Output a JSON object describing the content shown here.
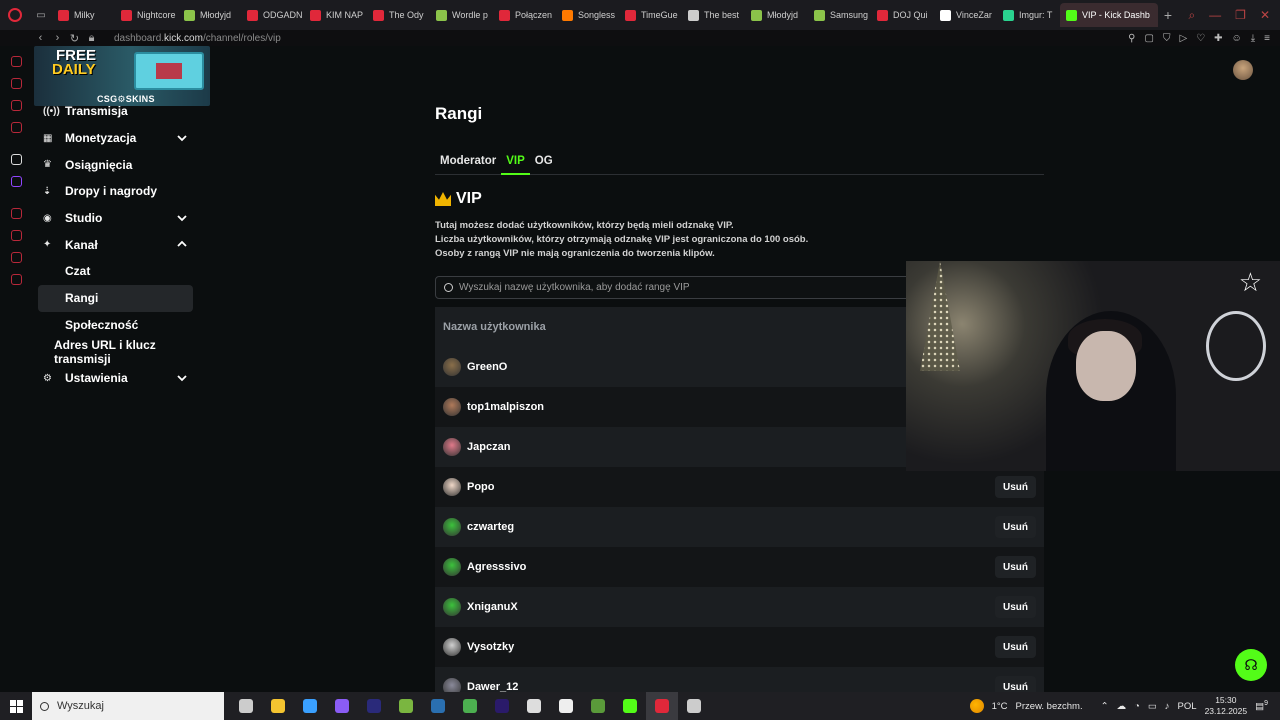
{
  "browser": {
    "tabs": [
      {
        "label": "Milky",
        "color": "#e0283a"
      },
      {
        "label": "Nightcore",
        "color": "#e0283a"
      },
      {
        "label": "Młodyjd",
        "color": "#8bc34a"
      },
      {
        "label": "ODGADN",
        "color": "#e0283a"
      },
      {
        "label": "KIM NAP",
        "color": "#e0283a"
      },
      {
        "label": "The Ody",
        "color": "#e0283a"
      },
      {
        "label": "Wordle p",
        "color": "#8bc34a"
      },
      {
        "label": "Połączen",
        "color": "#e0283a"
      },
      {
        "label": "Songless",
        "color": "#ff7a00"
      },
      {
        "label": "TimeGue",
        "color": "#e0283a"
      },
      {
        "label": "The best",
        "color": "#cccccc"
      },
      {
        "label": "Młodyjd",
        "color": "#8bc34a"
      },
      {
        "label": "Samsung",
        "color": "#8bc34a"
      },
      {
        "label": "DOJ Qui",
        "color": "#e0283a"
      },
      {
        "label": "VinceZar",
        "color": "#ffffff"
      },
      {
        "label": "Imgur: T",
        "color": "#2ad38f"
      },
      {
        "label": "VIP - Kick Dashb",
        "color": "#53fc18",
        "active": true
      }
    ],
    "url_prefix": "dashboard.",
    "url_domain": "kick.com",
    "url_path": "/channel/roles/vip"
  },
  "promo": {
    "line1": "FREE",
    "line2": "DAILY",
    "brand": "CSG⚙SKINS"
  },
  "sidebar": {
    "items": [
      {
        "label": "Transmisja",
        "icon": "broadcast-icon",
        "glyph": "((•))"
      },
      {
        "label": "Monetyzacja",
        "icon": "money-icon",
        "glyph": "▦",
        "chevron": "down"
      },
      {
        "label": "Osiągnięcia",
        "icon": "trophy-icon",
        "glyph": "♛"
      },
      {
        "label": "Dropy i nagrody",
        "icon": "drops-icon",
        "glyph": "⇣"
      },
      {
        "label": "Studio",
        "icon": "studio-icon",
        "glyph": "◉",
        "chevron": "down"
      },
      {
        "label": "Kanał",
        "icon": "channel-icon",
        "glyph": "✦",
        "chevron": "up"
      },
      {
        "label": "Czat",
        "sub": true
      },
      {
        "label": "Rangi",
        "sub": true,
        "active": true
      },
      {
        "label": "Społeczność",
        "sub": true
      },
      {
        "label": "Adres URL i klucz transmisji",
        "sub2": true
      },
      {
        "label": "Ustawienia",
        "icon": "settings-gear-icon",
        "glyph": "⚙",
        "chevron": "down"
      }
    ]
  },
  "main": {
    "title": "Rangi",
    "tabs": [
      {
        "label": "Moderator"
      },
      {
        "label": "VIP",
        "active": true
      },
      {
        "label": "OG"
      }
    ],
    "section_title": "VIP",
    "description": [
      "Tutaj możesz dodać użytkowników, którzy będą mieli odznakę VIP.",
      "Liczba użytkowników, którzy otrzymają odznakę VIP jest ograniczona do 100 osób.",
      "Osoby z rangą VIP nie mają ograniczenia do tworzenia klipów."
    ],
    "search_placeholder": "Wyszukaj nazwę użytkownika, aby dodać rangę VIP",
    "column_header": "Nazwa użytkownika",
    "remove_label": "Usuń",
    "users": [
      {
        "name": "GreenO",
        "avatar_color": "#8a6f4a",
        "show_remove": false
      },
      {
        "name": "top1malpiszon",
        "avatar_color": "#b07a5a",
        "show_remove": false
      },
      {
        "name": "Japczan",
        "avatar_color": "#e07a8a",
        "show_remove": false
      },
      {
        "name": "Popo",
        "avatar_color": "#f0d8c8",
        "show_remove": true
      },
      {
        "name": "czwarteg",
        "avatar_color": "#3cc23c",
        "show_remove": true
      },
      {
        "name": "Agresssivo",
        "avatar_color": "#3cc23c",
        "show_remove": true
      },
      {
        "name": "XniganuX",
        "avatar_color": "#3cc23c",
        "show_remove": true
      },
      {
        "name": "Vysotzky",
        "avatar_color": "#d0d0d0",
        "show_remove": true
      },
      {
        "name": "Dawer_12",
        "avatar_color": "#8a8a9a",
        "show_remove": true
      }
    ]
  },
  "taskbar": {
    "search_placeholder": "Wyszukaj",
    "apps": [
      {
        "icon": "task-view-icon",
        "color": "#cccccc"
      },
      {
        "icon": "file-explorer-icon",
        "color": "#f4c430"
      },
      {
        "icon": "vscode-icon",
        "color": "#3aa0ff"
      },
      {
        "icon": "obsidian-icon",
        "color": "#8a5cf5"
      },
      {
        "icon": "after-effects-icon",
        "color": "#2a2a7a"
      },
      {
        "icon": "game-icon",
        "color": "#7ab640"
      },
      {
        "icon": "steam-icon",
        "color": "#2a6fb0"
      },
      {
        "icon": "sheets-icon",
        "color": "#4caf50"
      },
      {
        "icon": "premiere-icon",
        "color": "#2a1a6a"
      },
      {
        "icon": "settings-icon",
        "color": "#dddddd"
      },
      {
        "icon": "steelseries-icon",
        "color": "#eeeeee"
      },
      {
        "icon": "minecraft-icon",
        "color": "#5a9a3a"
      },
      {
        "icon": "kick-app-icon",
        "color": "#53fc18"
      },
      {
        "icon": "opera-icon",
        "color": "#e0283a",
        "active": true
      },
      {
        "icon": "obs-icon",
        "color": "#cccccc"
      }
    ],
    "weather_temp": "1°C",
    "weather_desc": "Przew. bezchm.",
    "language": "POL",
    "time": "15:30",
    "date": "23.12.2025",
    "notification_count": "9"
  }
}
